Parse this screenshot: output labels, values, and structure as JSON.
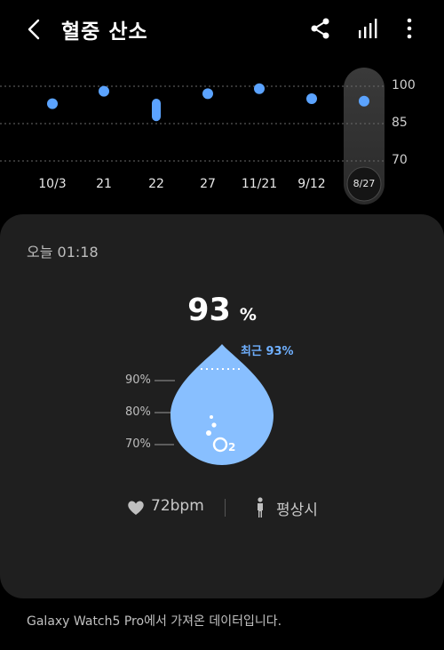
{
  "header": {
    "title": "혈중 산소",
    "icons": [
      "back-icon",
      "share-icon",
      "bar-chart-icon",
      "more-vert-icon"
    ]
  },
  "chart_data": {
    "type": "scatter",
    "categories": [
      "10/3",
      "21",
      "22",
      "27",
      "11/21",
      "9/12",
      "8/27"
    ],
    "y_ticks": [
      "100",
      "85",
      "70"
    ],
    "ylim": [
      70,
      100
    ],
    "points": [
      93,
      98,
      null,
      97,
      99,
      95,
      94
    ],
    "range_22": [
      86,
      95
    ],
    "selected": "8/27",
    "grid": true,
    "accent": "#5ba3ff"
  },
  "card": {
    "time": "오늘 01:18",
    "value": "93",
    "unit": "%",
    "recent": "최근 93%",
    "levels": [
      "90%",
      "80%",
      "70%"
    ],
    "o2_label": "O",
    "o2_sub": "2",
    "heart_rate": "72bpm",
    "state": "평상시"
  },
  "footer": {
    "text": "Galaxy Watch5 Pro에서 가져온 데이터입니다."
  },
  "colors": {
    "background": "#000000",
    "card": "#1f1f1f",
    "accent": "#5ba3ff",
    "drop": "#88bfff"
  }
}
